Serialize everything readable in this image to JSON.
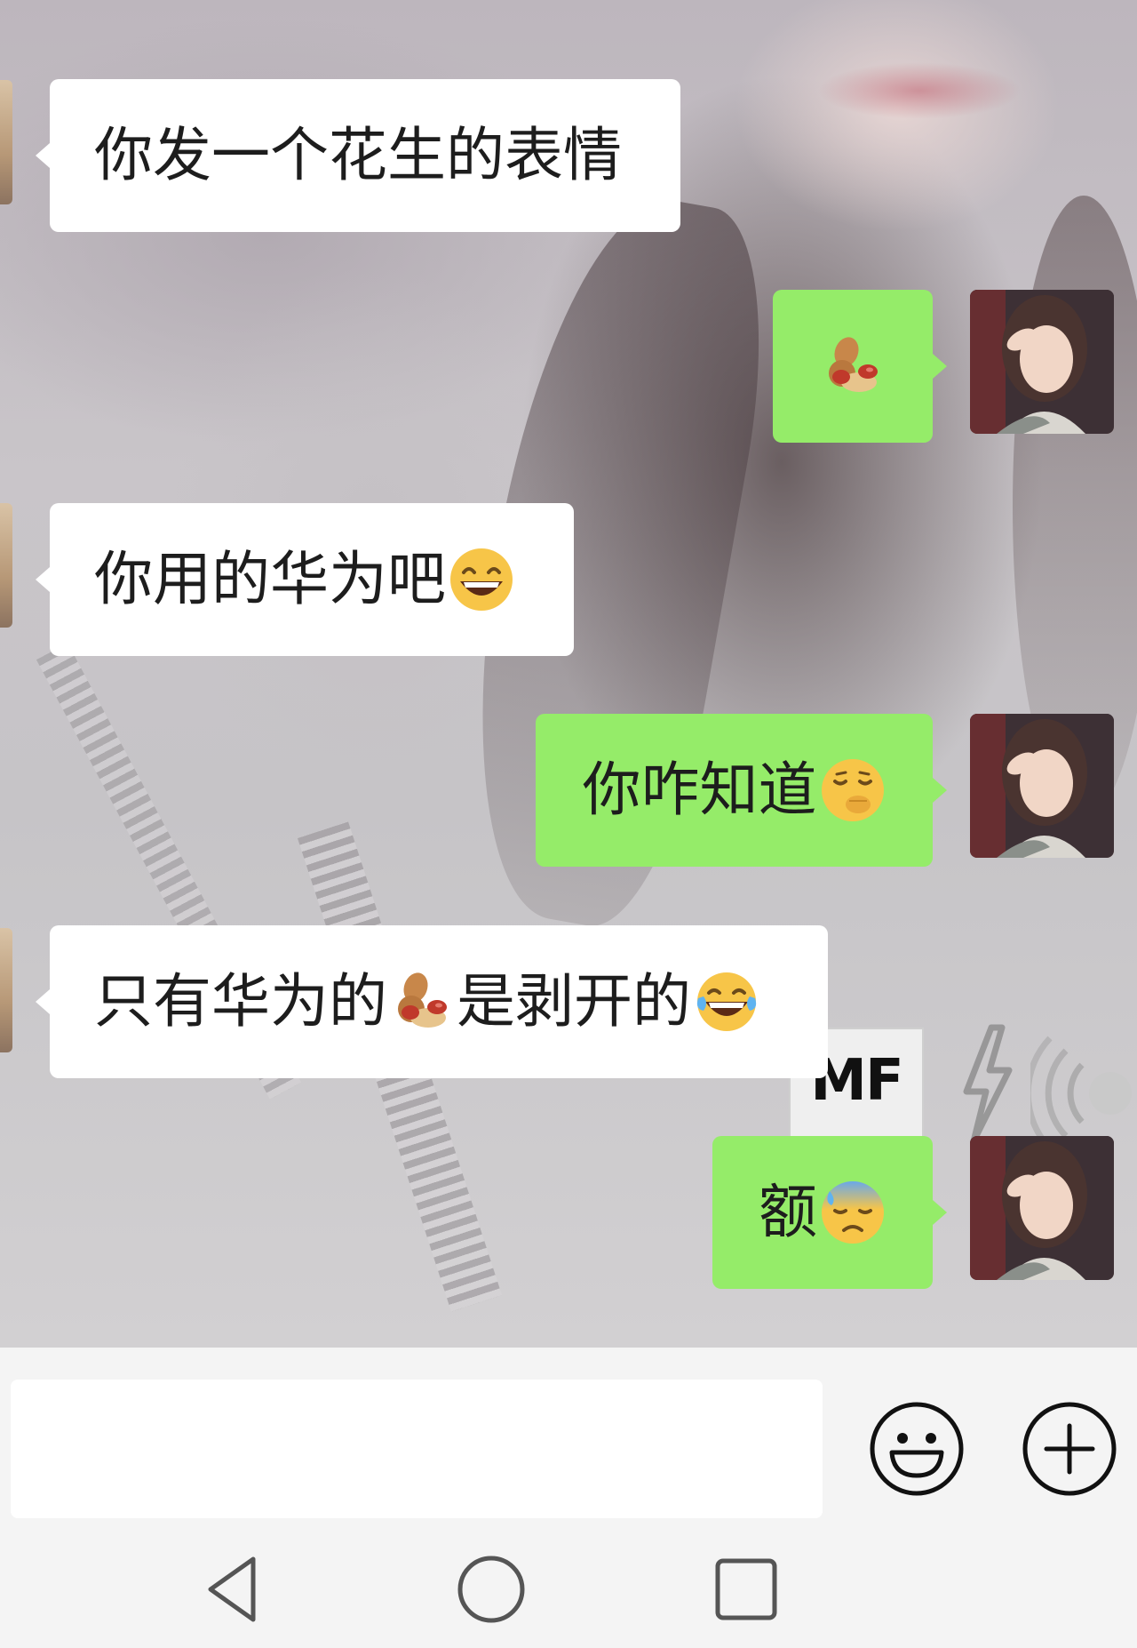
{
  "messages": [
    {
      "sender": "contact",
      "text": "你发一个花生的表情"
    },
    {
      "sender": "me",
      "text": "",
      "emoji": "peanut-emoji"
    },
    {
      "sender": "contact",
      "text": "你用的华为吧",
      "emoji": "grinning-face-emoji"
    },
    {
      "sender": "me",
      "text": "你咋知道",
      "emoji": "face-with-hand-over-mouth-emoji"
    },
    {
      "sender": "contact",
      "text_before": "只有华为的",
      "mid_emoji": "peanut-emoji",
      "text_after": "是剥开的",
      "emoji": "face-with-tears-of-joy-emoji"
    },
    {
      "sender": "me",
      "text": "额",
      "emoji": "anxious-face-with-sweat-emoji"
    }
  ],
  "background_sticker": {
    "text": "MF"
  },
  "input": {
    "value": "",
    "placeholder": ""
  },
  "icons": {
    "emoji_button": "smiley-icon",
    "more_button": "plus-circle-icon",
    "nav_back": "back-triangle-icon",
    "nav_home": "home-circle-icon",
    "nav_recents": "recents-square-icon"
  },
  "colors": {
    "outgoing_bubble": "#95ec69",
    "incoming_bubble": "#ffffff",
    "input_bar": "#f4f4f4"
  }
}
